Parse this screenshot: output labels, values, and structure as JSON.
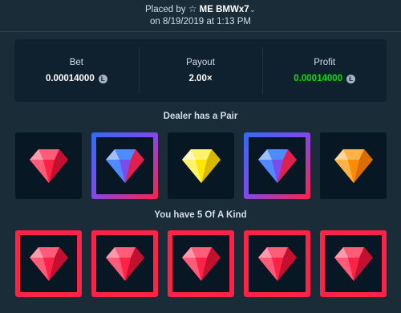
{
  "header": {
    "placed_by_prefix": "Placed by",
    "username": "ME BMWx7",
    "date_line": "on 8/19/2019 at 1:13 PM"
  },
  "stats": {
    "bet_label": "Bet",
    "bet_value": "0.00014000",
    "payout_label": "Payout",
    "payout_value": "2.00×",
    "profit_label": "Profit",
    "profit_value": "0.00014000",
    "coin_symbol": "Ł"
  },
  "dealer": {
    "title": "Dealer has a Pair",
    "gems": [
      {
        "type": "ruby",
        "highlight": "none"
      },
      {
        "type": "sapphire",
        "highlight": "gradient"
      },
      {
        "type": "topaz",
        "highlight": "none"
      },
      {
        "type": "sapphire",
        "highlight": "gradient"
      },
      {
        "type": "amber",
        "highlight": "none"
      }
    ]
  },
  "player": {
    "title": "You have 5 Of A Kind",
    "gems": [
      {
        "type": "ruby",
        "highlight": "red"
      },
      {
        "type": "ruby",
        "highlight": "red"
      },
      {
        "type": "ruby",
        "highlight": "red"
      },
      {
        "type": "ruby",
        "highlight": "red"
      },
      {
        "type": "ruby",
        "highlight": "red"
      }
    ]
  },
  "colors": {
    "background": "#1a2c38",
    "panel": "#0f212e",
    "profit_green": "#00e701",
    "win_red": "#fe2247"
  }
}
